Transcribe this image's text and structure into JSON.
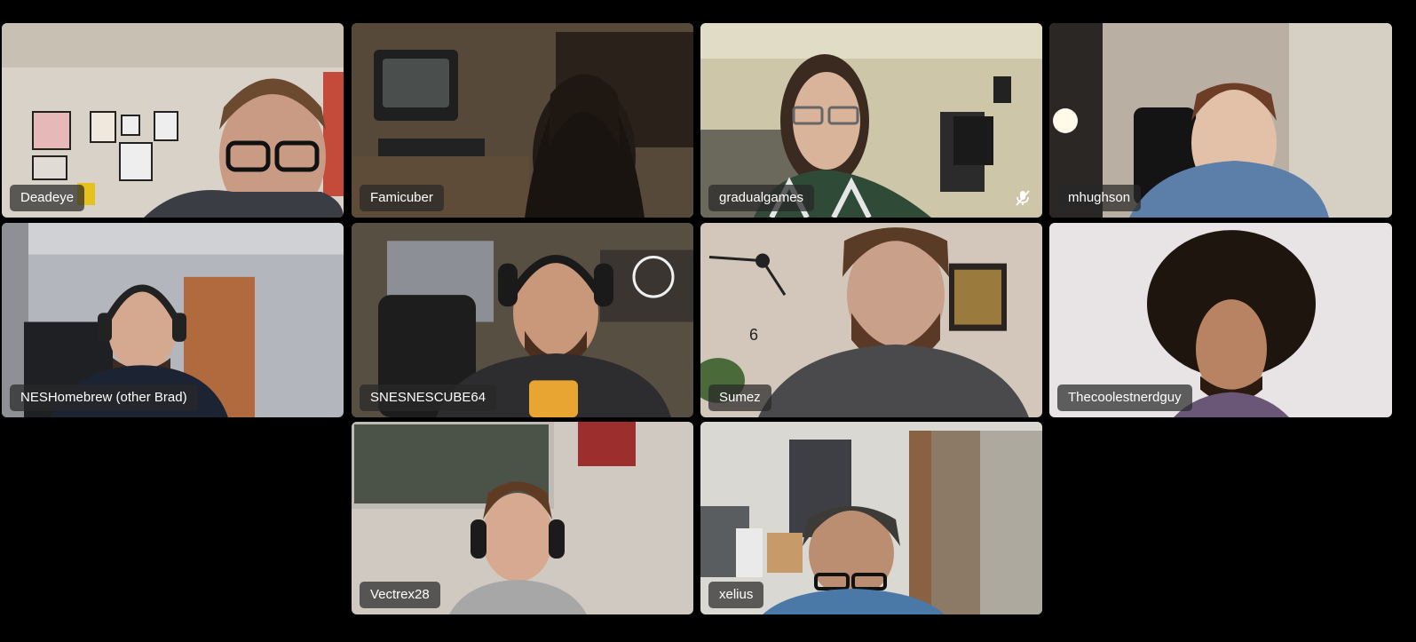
{
  "meeting": {
    "participants": [
      {
        "name": "Deadeye",
        "active": false,
        "muted": false
      },
      {
        "name": "Famicuber",
        "active": true,
        "muted": false
      },
      {
        "name": "gradualgames",
        "active": false,
        "muted": true
      },
      {
        "name": "mhughson",
        "active": false,
        "muted": false
      },
      {
        "name": "NESHomebrew (other Brad)",
        "active": false,
        "muted": false
      },
      {
        "name": "SNESNESCUBE64",
        "active": false,
        "muted": false
      },
      {
        "name": "Sumez",
        "active": false,
        "muted": false
      },
      {
        "name": "Thecoolestnerdguy",
        "active": false,
        "muted": false
      },
      {
        "name": "Vectrex28",
        "active": false,
        "muted": false
      },
      {
        "name": "xelius",
        "active": true,
        "muted": false
      }
    ]
  },
  "colors": {
    "background": "#000000",
    "active_border": "#2fbf71",
    "name_tag_bg": "rgba(40,40,40,0.72)"
  }
}
